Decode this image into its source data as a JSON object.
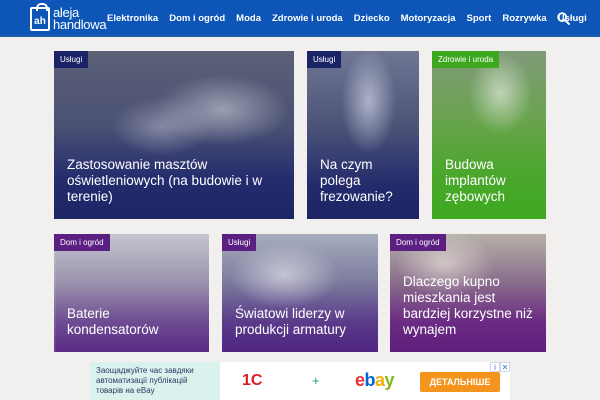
{
  "header": {
    "logo_mark": "ah",
    "logo_line1": "aleja",
    "logo_line2": "handlowa",
    "nav": [
      "Elektronika",
      "Dom i ogród",
      "Moda",
      "Zdrowie i uroda",
      "Dziecko",
      "Motoryzacja",
      "Sport",
      "Rozrywka",
      "Usługi"
    ],
    "search_icon": "search-icon"
  },
  "cards": [
    {
      "tag": "Usługi",
      "title": "Zastosowanie masztów oświetleniowych (na budowie i w terenie)"
    },
    {
      "tag": "Usługi",
      "title": "Na czym polega frezowanie?"
    },
    {
      "tag": "Zdrowie i uroda",
      "title": "Budowa implantów zębowych"
    },
    {
      "tag": "Dom i ogród",
      "title": "Baterie kondensatorów"
    },
    {
      "tag": "Usługi",
      "title": "Światowi liderzy w produkcji armatury"
    },
    {
      "tag": "Dom i ogród",
      "title": "Dlaczego kupno mieszkania jest bardziej korzystne niż wynajem"
    }
  ],
  "ad": {
    "text": "Заощаджуйте час завдяки автоматизації публікацій товарів на eBay",
    "brand1": "1С",
    "plus": "+",
    "brand2_letters": [
      "e",
      "b",
      "a",
      "y"
    ],
    "button": "ДЕТАЛЬНІШЕ",
    "info_icon": "i",
    "close_icon": "✕"
  },
  "colors": {
    "header": "#0d56b8",
    "tag_blue": "#1b2367",
    "tag_purple": "#5a1f80",
    "tag_green": "#3da81e",
    "ebay": [
      "#e53238",
      "#0064d2",
      "#f5af02",
      "#86b817"
    ]
  }
}
